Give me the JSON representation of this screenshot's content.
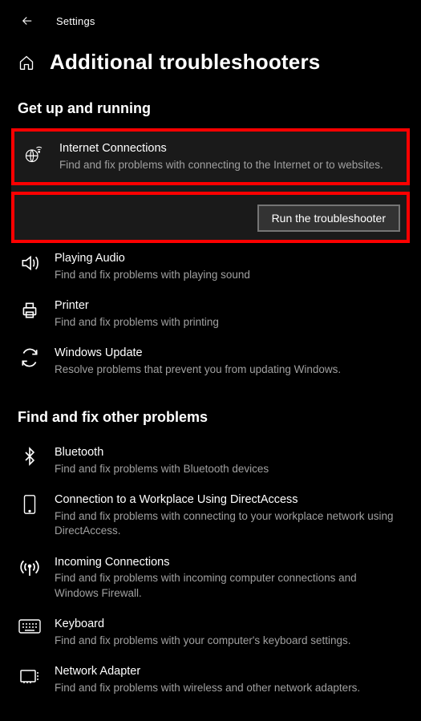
{
  "app": {
    "title": "Settings"
  },
  "page": {
    "title": "Additional troubleshooters"
  },
  "sections": {
    "getUp": {
      "heading": "Get up and running",
      "items": [
        {
          "title": "Internet Connections",
          "desc": "Find and fix problems with connecting to the Internet or to websites.",
          "runLabel": "Run the troubleshooter"
        },
        {
          "title": "Playing Audio",
          "desc": "Find and fix problems with playing sound"
        },
        {
          "title": "Printer",
          "desc": "Find and fix problems with printing"
        },
        {
          "title": "Windows Update",
          "desc": "Resolve problems that prevent you from updating Windows."
        }
      ]
    },
    "other": {
      "heading": "Find and fix other problems",
      "items": [
        {
          "title": "Bluetooth",
          "desc": "Find and fix problems with Bluetooth devices"
        },
        {
          "title": "Connection to a Workplace Using DirectAccess",
          "desc": "Find and fix problems with connecting to your workplace network using DirectAccess."
        },
        {
          "title": "Incoming Connections",
          "desc": "Find and fix problems with incoming computer connections and Windows Firewall."
        },
        {
          "title": "Keyboard",
          "desc": "Find and fix problems with your computer's keyboard settings."
        },
        {
          "title": "Network Adapter",
          "desc": "Find and fix problems with wireless and other network adapters."
        }
      ]
    }
  }
}
